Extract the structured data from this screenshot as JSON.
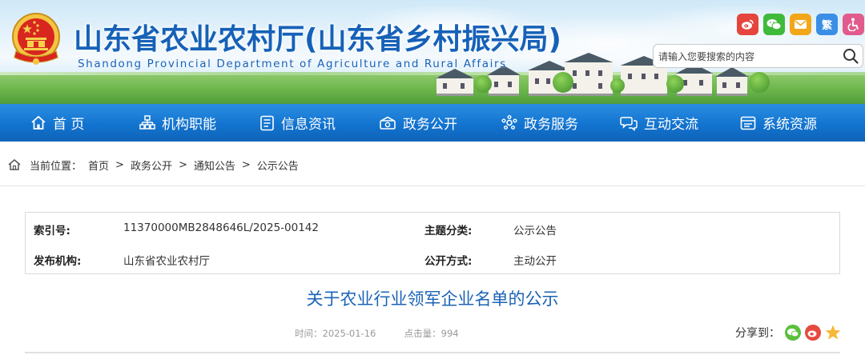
{
  "header": {
    "site_title": "山东省农业农村厅(山东省乡村振兴局)",
    "site_subtitle": "Shandong Provincial Department of Agriculture and Rural Affairs",
    "tools": [
      {
        "name": "weibo-icon",
        "color": "#e5453c"
      },
      {
        "name": "wechat-icon",
        "color": "#3fba3a"
      },
      {
        "name": "email-icon",
        "color": "#f2a71a"
      },
      {
        "name": "traditional-chinese-toggle",
        "label": "繁",
        "color": "#3a8ee6"
      },
      {
        "name": "accessibility-icon",
        "color": "#e15c8c"
      }
    ],
    "search": {
      "placeholder": "请输入您要搜索的内容"
    }
  },
  "nav": {
    "items": [
      {
        "label": "首 页",
        "icon": "home-icon"
      },
      {
        "label": "机构职能",
        "icon": "org-chart-icon"
      },
      {
        "label": "信息资讯",
        "icon": "news-icon"
      },
      {
        "label": "政务公开",
        "icon": "disclosure-icon"
      },
      {
        "label": "政务服务",
        "icon": "service-icon"
      },
      {
        "label": "互动交流",
        "icon": "interaction-icon"
      },
      {
        "label": "系统资源",
        "icon": "resources-icon"
      }
    ]
  },
  "breadcrumb": {
    "prefix": "当前位置：",
    "items": [
      "首页",
      "政务公开",
      "通知公告",
      "公示公告"
    ],
    "separator": ">"
  },
  "meta": {
    "index_label": "索引号:",
    "index_value": "11370000MB2848646L/2025-00142",
    "category_label": "主题分类:",
    "category_value": "公示公告",
    "publisher_label": "发布机构:",
    "publisher_value": "山东省农业农村厅",
    "disclosure_label": "公开方式:",
    "disclosure_value": "主动公开"
  },
  "article": {
    "title": "关于农业行业领军企业名单的公示",
    "time_label": "时间：",
    "time_value": "2025-01-16",
    "clicks_label": "点击量：",
    "clicks_value": "994",
    "share_label": "分享到："
  },
  "colors": {
    "brand_blue": "#1661b8",
    "nav_blue": "#1374d0",
    "title_blue": "#1b63b6"
  }
}
